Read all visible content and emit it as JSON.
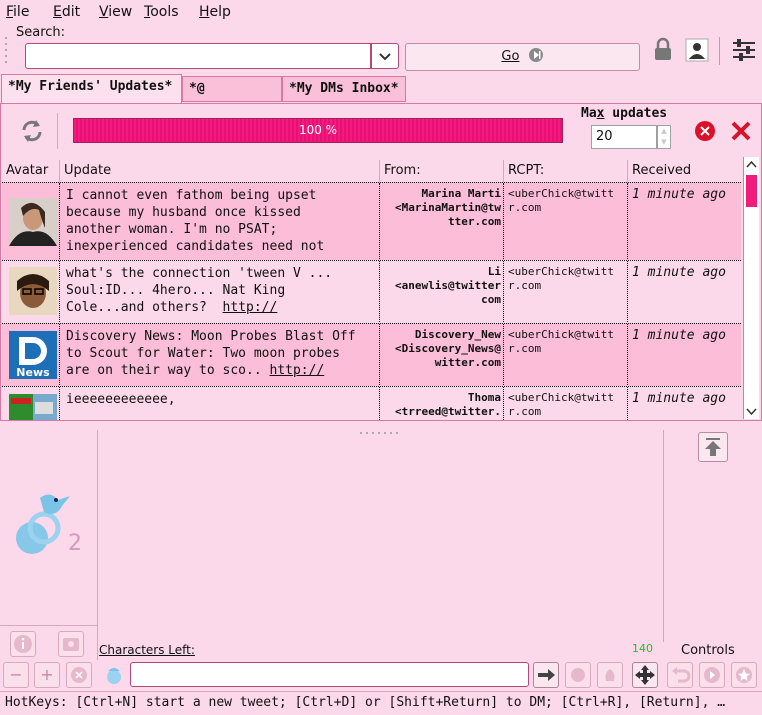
{
  "menubar": {
    "file": "File",
    "edit": "Edit",
    "view": "View",
    "tools": "Tools",
    "help": "Help"
  },
  "search": {
    "label": "Search:",
    "value": "",
    "go_label": "Go"
  },
  "tabs": [
    {
      "label": "*My Friends' Updates*"
    },
    {
      "label": "*@ Replies*"
    },
    {
      "label": "*My DMs Inbox*"
    }
  ],
  "toolbar": {
    "progress_text": "100 %",
    "progress": 1.0,
    "max_label": "Max updates",
    "max_value": "20"
  },
  "table": {
    "headers": {
      "avatar": "Avatar",
      "update": "Update",
      "from": "From:",
      "rcpt": "RCPT:",
      "received": "Received"
    },
    "rows": [
      {
        "update": "I cannot even fathom being upset\nbecause my husband once kissed\nanother woman. I'm no PSAT;\ninexperienced candidates need not",
        "from": "Marina Marti\n<MarinaMartin@tw\ntter.com",
        "rcpt": "<uberChick@twitt\nr.com",
        "received": "1 minute ago"
      },
      {
        "update_text": "what's the connection 'tween V ...\nSoul:ID... 4hero... Nat King\nCole...and others?  ",
        "update_link": "http://",
        "from": "Li\n<anewlis@twitter\ncom",
        "rcpt": "<uberChick@twitt\nr.com",
        "received": "1 minute ago"
      },
      {
        "update_text": "Discovery News: Moon Probes Blast Off\nto Scout for Water: Two moon probes\nare on their way to sco.. ",
        "update_link": "http://",
        "from": "Discovery_New\n<Discovery_News@\nwitter.com",
        "rcpt": "<uberChick@twitt\nr.com",
        "received": "1 minute ago"
      },
      {
        "update": "ieeeeeeeeeeee,",
        "from": "Thoma\n<trreed@twitter.",
        "rcpt": "<uberChick@twitt\nr.com",
        "received": "1 minute ago"
      }
    ]
  },
  "avatar_logo_text": "News",
  "compose": {
    "chars_left_label": "Characters Left:",
    "chars_left": "140",
    "controls_label": "Controls",
    "tweet_value": ""
  },
  "status": "HotKeys: [Ctrl+N] start a new tweet; [Ctrl+D] or [Shift+Return] to DM; [Ctrl+R], [Return], …",
  "colors": {
    "accent": "#f21c7f",
    "background": "#fcd9ea",
    "row_alt": "#fbbdd8",
    "border": "#d67aa4"
  }
}
